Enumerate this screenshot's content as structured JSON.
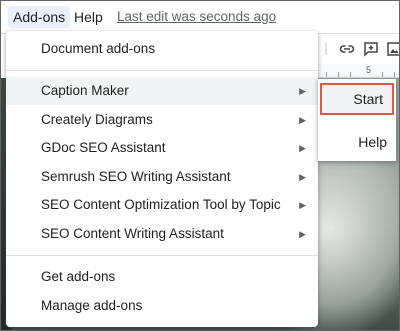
{
  "menubar": {
    "addons_label": "Add-ons",
    "help_label": "Help",
    "last_edit": "Last edit was seconds ago"
  },
  "ruler": {
    "number": "5"
  },
  "dropdown": {
    "header_item": "Document add-ons",
    "addons": [
      {
        "label": "Caption Maker",
        "has_submenu": true
      },
      {
        "label": "Creately Diagrams",
        "has_submenu": true
      },
      {
        "label": "GDoc SEO Assistant",
        "has_submenu": true
      },
      {
        "label": "Semrush SEO Writing Assistant",
        "has_submenu": true
      },
      {
        "label": "SEO Content Optimization Tool by Topic",
        "has_submenu": true
      },
      {
        "label": "SEO Content Writing Assistant",
        "has_submenu": true
      }
    ],
    "footer_items": [
      {
        "label": "Get add-ons"
      },
      {
        "label": "Manage add-ons"
      }
    ],
    "arrow_glyph": "▶"
  },
  "submenu": {
    "start_label": "Start",
    "help_label": "Help"
  },
  "colors": {
    "highlight_border": "#e0574b",
    "active_menu_bg": "#e8f0fe"
  }
}
